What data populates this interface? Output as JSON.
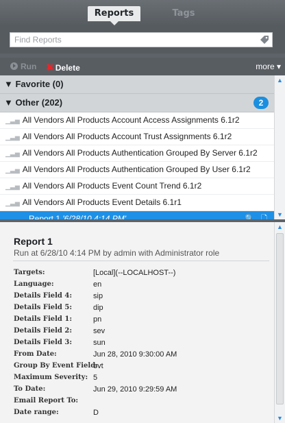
{
  "tabs": {
    "reports": "Reports",
    "tags": "Tags"
  },
  "search": {
    "placeholder": "Find Reports"
  },
  "toolbar": {
    "run": "Run",
    "delete": "Delete",
    "more": "more ▾"
  },
  "groups": [
    {
      "label": "▼ Favorite (0)"
    },
    {
      "label": "▼ Other (202)",
      "badge": "2"
    }
  ],
  "reports": [
    "All Vendors All Products Account Access Assignments 6.1r2",
    "All Vendors All Products Account Trust Assignments 6.1r2",
    "All Vendors All Products Authentication Grouped By Server 6.1r2",
    "All Vendors All Products Authentication Grouped By User 6.1r2",
    "All Vendors All Products Event Count Trend 6.1r2",
    "All Vendors All Products Event Details 6.1r1"
  ],
  "selected_run": {
    "name": "Report 1",
    "time": "'6/28/10 4:14 PM'"
  },
  "detail": {
    "title": "Report 1",
    "subtitle": "Run at 6/28/10 4:14 PM by admin with Administrator role",
    "fields": [
      {
        "key": "Targets:",
        "value": "[Local](--LOCALHOST--)"
      },
      {
        "key": "Language:",
        "value": "en"
      },
      {
        "key": "Details Field 4:",
        "value": "sip"
      },
      {
        "key": "Details Field 5:",
        "value": "dip"
      },
      {
        "key": "Details Field 1:",
        "value": "pn"
      },
      {
        "key": "Details Field 2:",
        "value": "sev"
      },
      {
        "key": "Details Field 3:",
        "value": "sun"
      },
      {
        "key": "From Date:",
        "value": "Jun 28, 2010 9:30:00 AM"
      },
      {
        "key": "Group By Event Field:",
        "value": "evt"
      },
      {
        "key": "Maximum Severity:",
        "value": "5"
      },
      {
        "key": "To Date:",
        "value": "Jun 29, 2010 9:29:59 AM"
      },
      {
        "key": "Email Report To:",
        "value": ""
      },
      {
        "key": "Date range:",
        "value": "D"
      }
    ]
  }
}
